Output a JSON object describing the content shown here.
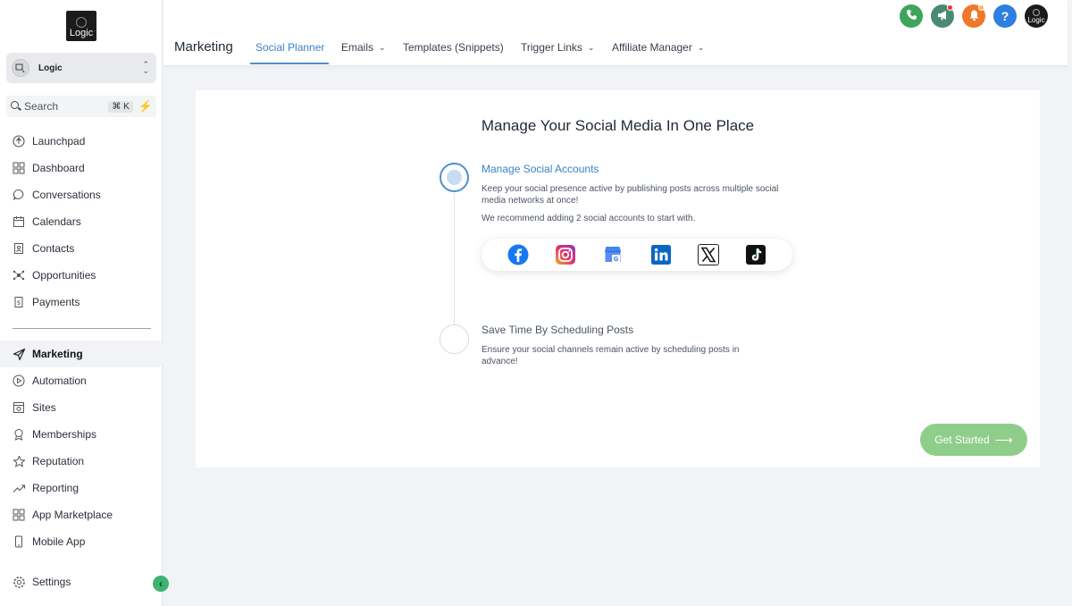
{
  "brand": {
    "logo_text": "Logic"
  },
  "account": {
    "name": "Logic"
  },
  "search": {
    "label": "Search",
    "shortcut": "⌘ K"
  },
  "sidebar": {
    "items": [
      {
        "label": "Launchpad",
        "icon": "launchpad-icon"
      },
      {
        "label": "Dashboard",
        "icon": "dashboard-grid-icon"
      },
      {
        "label": "Conversations",
        "icon": "chat-bubble-icon"
      },
      {
        "label": "Calendars",
        "icon": "calendar-icon"
      },
      {
        "label": "Contacts",
        "icon": "contacts-icon"
      },
      {
        "label": "Opportunities",
        "icon": "opportunities-icon"
      },
      {
        "label": "Payments",
        "icon": "payments-icon"
      },
      {
        "label": "Marketing",
        "icon": "send-plane-icon",
        "active": true
      },
      {
        "label": "Automation",
        "icon": "automation-icon"
      },
      {
        "label": "Sites",
        "icon": "sites-icon"
      },
      {
        "label": "Memberships",
        "icon": "memberships-icon"
      },
      {
        "label": "Reputation",
        "icon": "star-icon"
      },
      {
        "label": "Reporting",
        "icon": "trend-icon"
      },
      {
        "label": "App Marketplace",
        "icon": "apps-grid-icon"
      },
      {
        "label": "Mobile App",
        "icon": "mobile-icon"
      }
    ],
    "settings_label": "Settings"
  },
  "header": {
    "title": "Marketing",
    "tabs": [
      {
        "label": "Social Planner",
        "active": true,
        "dropdown": false
      },
      {
        "label": "Emails",
        "dropdown": true
      },
      {
        "label": "Templates (Snippets)",
        "dropdown": false
      },
      {
        "label": "Trigger Links",
        "dropdown": true
      },
      {
        "label": "Affiliate Manager",
        "dropdown": true
      }
    ],
    "icons": [
      {
        "name": "phone-icon",
        "color": "#3fa55b"
      },
      {
        "name": "megaphone-icon",
        "color": "#4b8a72"
      },
      {
        "name": "bell-icon",
        "color": "#f0782a"
      },
      {
        "name": "help-icon",
        "color": "#2f7fe0"
      },
      {
        "name": "profile-avatar",
        "color": "#1b1b1b",
        "text": "Logic"
      }
    ]
  },
  "main": {
    "title": "Manage Your Social Media In One Place",
    "step1": {
      "title": "Manage Social Accounts",
      "desc": "Keep your social presence active by publishing posts across multiple social media networks at once!",
      "note": "We recommend adding 2 social accounts to start with."
    },
    "socials": [
      "facebook-icon",
      "instagram-icon",
      "google-business-icon",
      "linkedin-icon",
      "x-icon",
      "tiktok-icon"
    ],
    "step2": {
      "title": "Save Time By Scheduling Posts",
      "desc": "Ensure your social channels remain active by scheduling posts in advance!"
    },
    "cta": "Get Started"
  },
  "colors": {
    "accent": "#3b82c4",
    "cta": "#8fce8a",
    "collapse": "#3cb371"
  }
}
